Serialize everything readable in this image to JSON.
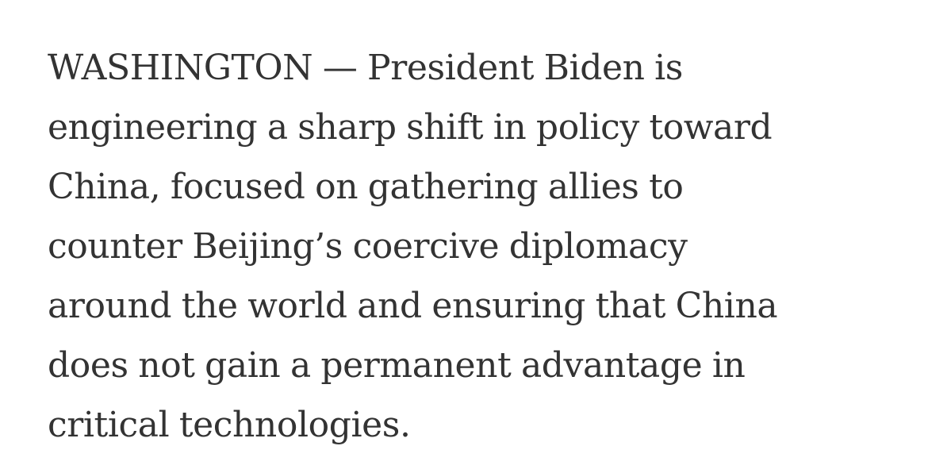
{
  "article": {
    "lines": [
      "WASHINGTON — President Biden is",
      "engineering a sharp shift in policy toward",
      "China, focused on gathering allies to",
      "counter Beijing’s coercive diplomacy",
      "around the world and ensuring that China",
      "does not gain a permanent advantage in",
      "critical technologies."
    ]
  }
}
